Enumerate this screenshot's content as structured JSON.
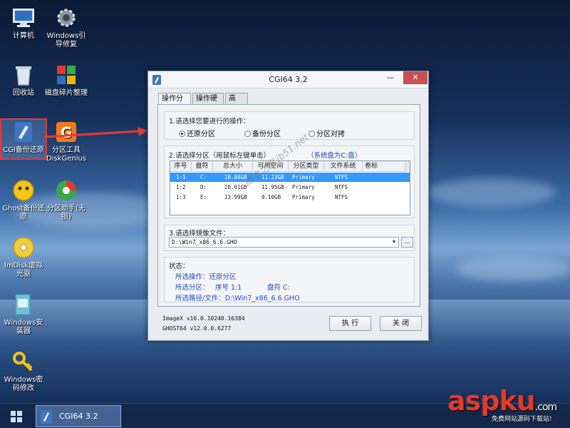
{
  "desktop": {
    "icons": [
      {
        "label": "计算机",
        "icon": "computer-icon"
      },
      {
        "label": "Windows引导修复",
        "icon": "gear-icon"
      },
      {
        "label": "回收站",
        "icon": "recycle-bin-icon"
      },
      {
        "label": "磁盘碎片整理",
        "icon": "defrag-icon"
      },
      {
        "label": "CGI备份还原",
        "icon": "cgi-icon"
      },
      {
        "label": "分区工具DiskGenius",
        "icon": "diskgenius-icon"
      },
      {
        "label": "Ghost备份还原",
        "icon": "ghost-icon"
      },
      {
        "label": "分区助手(无损)",
        "icon": "partition-assistant-icon"
      },
      {
        "label": "ImDisk虚拟光驱",
        "icon": "imdisk-icon"
      },
      {
        "label": "Windows安装器",
        "icon": "windows-installer-icon"
      },
      {
        "label": "Windows密码修改",
        "icon": "key-icon"
      }
    ]
  },
  "window": {
    "title": "CGI64  3.2",
    "min_label": "—",
    "close_label": "✕",
    "tabs": [
      "操作分区",
      "操作硬盘",
      "高 级"
    ],
    "section1": {
      "label": "1.请选择您要进行的操作：",
      "options": [
        "还原分区",
        "备份分区",
        "分区对拷"
      ],
      "selected": "还原分区"
    },
    "section2": {
      "label": "2.请选择分区（用鼠标左键单击）",
      "system_disk": "（系统盘为C:盘）",
      "columns": [
        "序号",
        "盘符",
        "总大小",
        "可用空间",
        "分区类型",
        "文件系统",
        "卷标"
      ],
      "rows": [
        {
          "index": "1:1",
          "drive": "C:",
          "total": "18.00GB",
          "free": "11.23GB",
          "type": "Primary",
          "fs": "NTFS",
          "label": ""
        },
        {
          "index": "1:2",
          "drive": "D:",
          "total": "28.01GB",
          "free": "11.95GB",
          "type": "Primary",
          "fs": "NTFS",
          "label": ""
        },
        {
          "index": "1:3",
          "drive": "E:",
          "total": "13.99GB",
          "free": "0.10GB",
          "type": "Primary",
          "fs": "NTFS",
          "label": ""
        }
      ],
      "selected_row": 0
    },
    "section3": {
      "label": "3.请选择镜像文件：",
      "value": "D:\\Win7_x86_6.6.GHO",
      "browse_label": "..."
    },
    "status": {
      "label": "状态：",
      "operation": "所选操作：还原分区",
      "partition_prefix": "所选分区：",
      "partition_index": "序号 1:1",
      "partition_drive": "盘符 C:",
      "path": "所选路径/文件：D:\\Win7_x86_6.6.GHO"
    },
    "versions": [
      "ImageX v10.0.10240.16384",
      "GHOST64 v12.0.0.6277"
    ],
    "execute_label": "执 行",
    "close_button_label": "关 闭"
  },
  "watermark": "脚本之家 jb51.net",
  "taskbar": {
    "item_label": "CGI64  3.2"
  },
  "brand": {
    "name": "aspku",
    "suffix": ".com",
    "tagline": "免费网站源码下载站!"
  },
  "colors": {
    "accent": "#3399ff",
    "status_text": "#1f4cbf",
    "close_button": "#c75050",
    "brand": "#e23a2a"
  }
}
